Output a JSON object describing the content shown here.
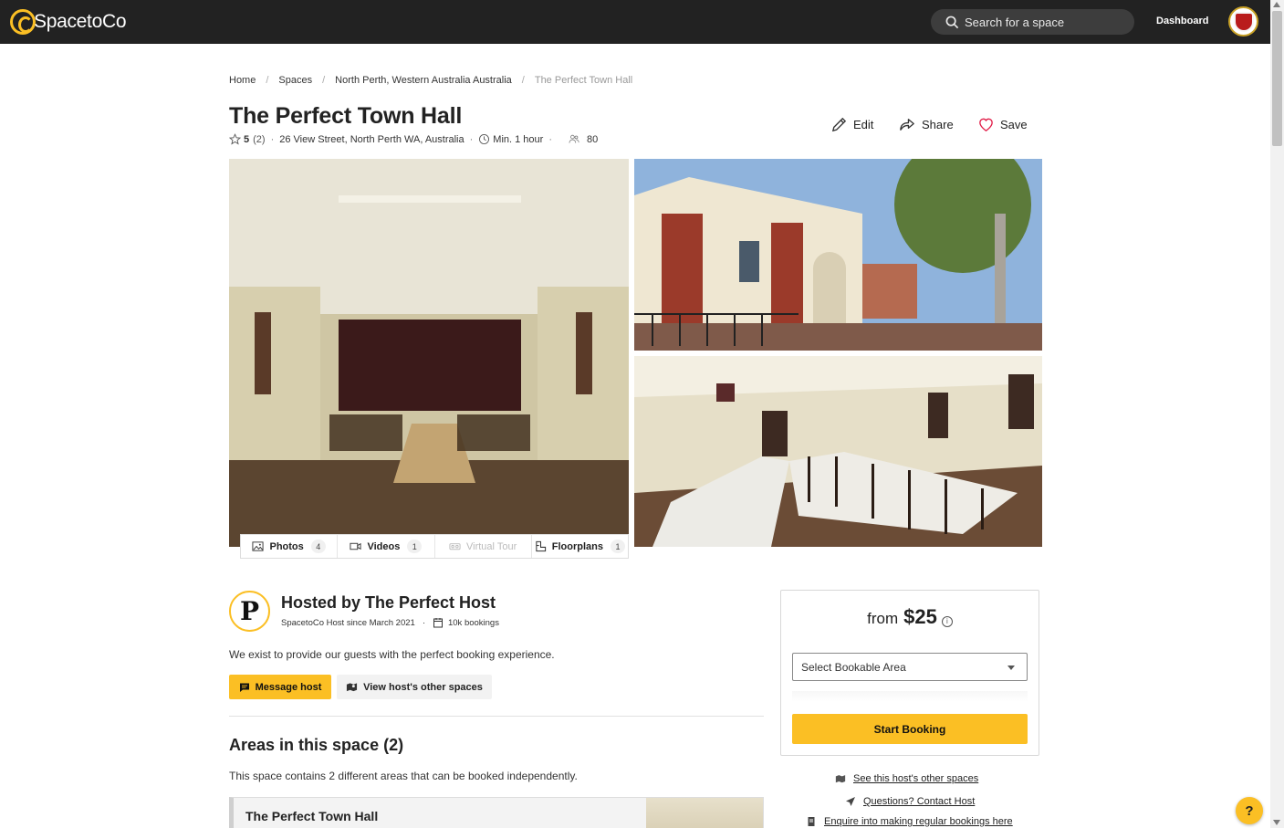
{
  "header": {
    "logo_text": "SpacetoCo",
    "search_placeholder": "Search for a space",
    "dashboard_label": "Dashboard"
  },
  "breadcrumb": [
    "Home",
    "Spaces",
    "North Perth, Western Australia Australia",
    "The Perfect Town Hall"
  ],
  "listing": {
    "title": "The Perfect Town Hall",
    "rating": "5",
    "review_count": "(2)",
    "address": "26 View Street, North Perth WA, Australia",
    "min_duration": "Min. 1 hour",
    "capacity": "80",
    "actions": {
      "edit": "Edit",
      "share": "Share",
      "save": "Save"
    }
  },
  "media_tabs": [
    {
      "label": "Photos",
      "count": "4"
    },
    {
      "label": "Videos",
      "count": "1"
    },
    {
      "label": "Virtual Tour",
      "count": ""
    },
    {
      "label": "Floorplans",
      "count": "1"
    }
  ],
  "host": {
    "title": "Hosted by The Perfect Host",
    "since": "SpacetoCo Host since March 2021",
    "bookings": "10k bookings",
    "description": "We exist to provide our guests with the perfect booking experience.",
    "message_button": "Message host",
    "other_spaces_button": "View host's other spaces"
  },
  "areas": {
    "title": "Areas in this space (2)",
    "description": "This space contains 2 different areas that can be booked independently.",
    "items": [
      {
        "name": "The Perfect Town Hall"
      }
    ]
  },
  "booking": {
    "from_label": "from",
    "price": "$25",
    "select_placeholder": "Select Bookable Area",
    "start_button": "Start Booking"
  },
  "side_links": {
    "other_spaces": "See this host's other spaces",
    "contact": "Questions? Contact Host",
    "regular": "Enquire into making regular bookings here"
  },
  "help_label": "?",
  "colors": {
    "accent": "#fbbf24",
    "topbar": "#222222"
  }
}
